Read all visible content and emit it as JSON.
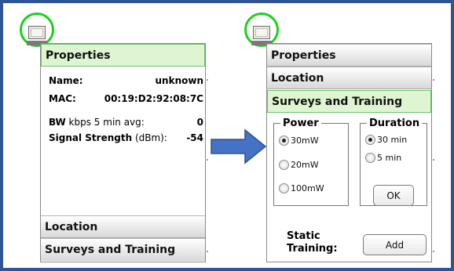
{
  "left_panel": {
    "header": "Properties",
    "name_label": "Name:",
    "name_value": "unknown",
    "mac_label": "MAC:",
    "mac_value": "00:19:D2:92:08:7C",
    "bw_label_bold": "BW",
    "bw_label_rest": " kbps 5 min avg:",
    "bw_value": "0",
    "signal_label_bold": "Signal Strength",
    "signal_label_rest": " (dBm):",
    "signal_value": "-54",
    "location": "Location",
    "surveys": "Surveys and Training"
  },
  "right_panel": {
    "properties": "Properties",
    "location": "Location",
    "surveys": "Surveys and Training",
    "power_legend": "Power",
    "power_options": [
      "30mW",
      "20mW",
      "100mW"
    ],
    "power_selected": "30mW",
    "duration_legend": "Duration",
    "duration_options": [
      "30 min",
      "5 min"
    ],
    "duration_selected": "30 min",
    "ok_label": "OK",
    "static_line1": "Static",
    "static_line2": "Training:",
    "add_label": "Add"
  },
  "icons": {
    "device": "computer-icon",
    "transition": "right-arrow-icon"
  },
  "colors": {
    "frame": "#2f5597",
    "highlight_ring": "#19d11b",
    "active_header": "#dff5d2",
    "arrow": "#4472c4"
  }
}
